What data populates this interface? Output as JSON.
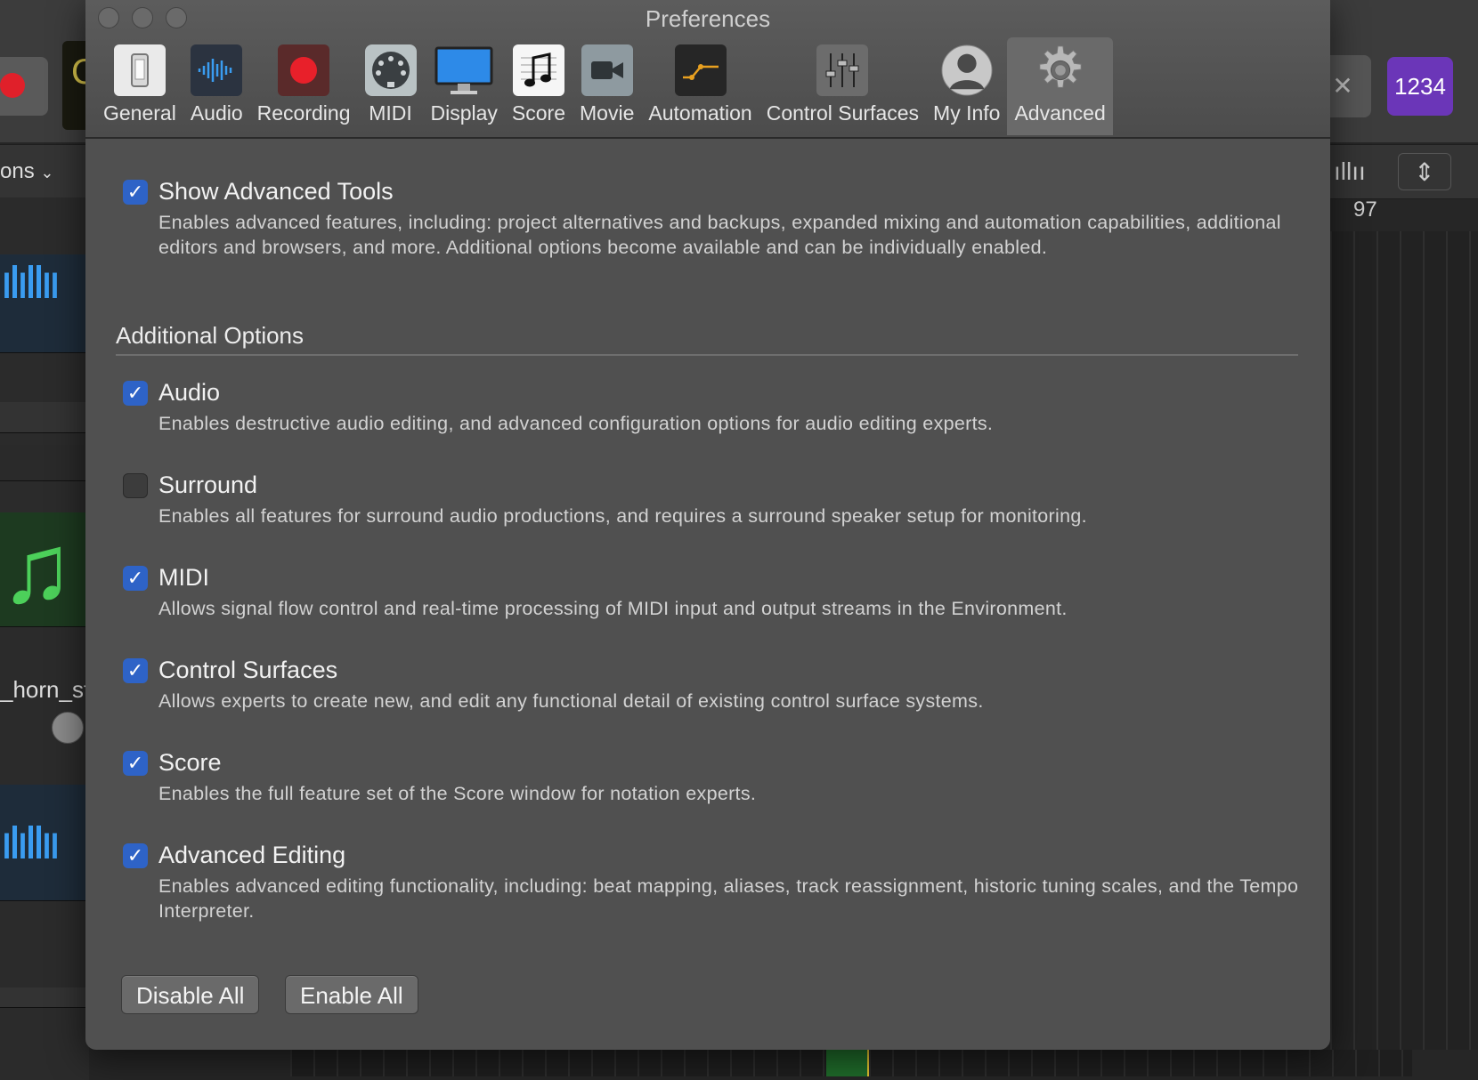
{
  "window": {
    "title": "Preferences"
  },
  "toolbar": {
    "items": [
      {
        "label": "General",
        "icon": "general-icon"
      },
      {
        "label": "Audio",
        "icon": "audio-waveform-icon"
      },
      {
        "label": "Recording",
        "icon": "record-icon"
      },
      {
        "label": "MIDI",
        "icon": "midi-connector-icon"
      },
      {
        "label": "Display",
        "icon": "display-monitor-icon"
      },
      {
        "label": "Score",
        "icon": "score-note-icon"
      },
      {
        "label": "Movie",
        "icon": "movie-camera-icon"
      },
      {
        "label": "Automation",
        "icon": "automation-icon"
      },
      {
        "label": "Control Surfaces",
        "icon": "control-surfaces-icon"
      },
      {
        "label": "My Info",
        "icon": "user-silhouette-icon"
      },
      {
        "label": "Advanced",
        "icon": "gear-icon"
      }
    ],
    "selected": "Advanced"
  },
  "advanced_tools": {
    "label": "Show Advanced Tools",
    "checked": true,
    "description": "Enables advanced features, including: project alternatives and backups, expanded mixing and automation capabilities, additional editors and browsers, and more. Additional options become available and can be individually enabled."
  },
  "additional_options": {
    "heading": "Additional Options",
    "items": [
      {
        "label": "Audio",
        "checked": true,
        "description": "Enables destructive audio editing, and advanced configuration options for audio editing experts."
      },
      {
        "label": "Surround",
        "checked": false,
        "description": "Enables all features for surround audio productions, and requires a surround speaker setup for monitoring."
      },
      {
        "label": "MIDI",
        "checked": true,
        "description": "Allows signal flow control and real-time processing of MIDI input and output streams in the Environment."
      },
      {
        "label": "Control Surfaces",
        "checked": true,
        "description": "Allows experts to create new, and edit any functional detail of existing control surface systems."
      },
      {
        "label": "Score",
        "checked": true,
        "description": "Enables the full feature set of the Score window for notation experts."
      },
      {
        "label": "Advanced Editing",
        "checked": true,
        "description": "Enables advanced editing functionality, including: beat mapping, aliases, track reassignment, historic tuning scales, and the Tempo Interpreter."
      }
    ]
  },
  "buttons": {
    "disable_all": "Disable All",
    "enable_all": "Enable All"
  },
  "background": {
    "lcd_char": "C",
    "counter": "1234",
    "selector_text": "ons",
    "ruler_number": "97",
    "track_name": "_horn_st"
  },
  "colors": {
    "checkbox_checked": "#2e63c7",
    "record_red": "#e0202a",
    "counter_purple": "#6b36b8",
    "waveform_blue": "#3a9cf0",
    "music_green": "#4cd05a"
  }
}
